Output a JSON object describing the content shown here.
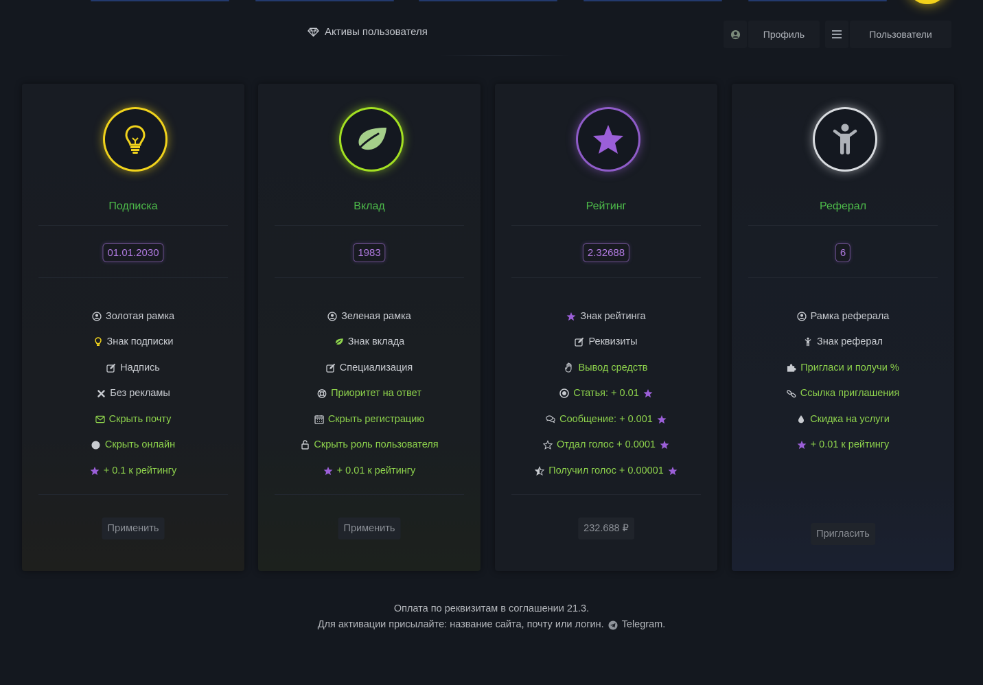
{
  "header": {
    "title": "Активы пользователя",
    "profile_label": "Профиль",
    "users_label": "Пользователи"
  },
  "cards": [
    {
      "title": "Подписка",
      "badge": "01.01.2030",
      "icon": "lightbulb-icon",
      "ring_color": "#f1d31c",
      "features": [
        {
          "icon": "user-circle-icon",
          "text": "Золотая рамка"
        },
        {
          "icon": "lightbulb-small-icon",
          "text": "Знак подписки"
        },
        {
          "icon": "edit-icon",
          "text": "Надпись"
        },
        {
          "icon": "cross-icon",
          "text": "Без рекламы"
        },
        {
          "icon": "envelope-icon",
          "text": "Скрыть почту"
        },
        {
          "icon": "circle-icon",
          "text": "Скрыть онлайн"
        },
        {
          "icon": "star-icon",
          "text": "+ 0.1 к рейтингу"
        }
      ],
      "action": "Применить"
    },
    {
      "title": "Вклад",
      "badge": "1983",
      "icon": "leaf-icon",
      "ring_color": "#a3e022",
      "features": [
        {
          "icon": "user-circle-icon",
          "text": "Зеленая рамка"
        },
        {
          "icon": "leaf-small-icon",
          "text": "Знак вклада"
        },
        {
          "icon": "edit-icon",
          "text": "Специализация"
        },
        {
          "icon": "lifebuoy-icon",
          "text": "Приоритет на ответ"
        },
        {
          "icon": "calendar-icon",
          "text": "Скрыть регистрацию"
        },
        {
          "icon": "unlock-icon",
          "text": "Скрыть роль пользователя"
        },
        {
          "icon": "star-icon",
          "text": "+ 0.01 к рейтингу"
        }
      ],
      "action": "Применить"
    },
    {
      "title": "Рейтинг",
      "badge": "2.32688",
      "icon": "star-large-icon",
      "ring_color": "#8f5cc9",
      "features": [
        {
          "icon": "star-icon",
          "text": "Знак рейтинга"
        },
        {
          "icon": "edit-icon",
          "text": "Реквизиты"
        },
        {
          "icon": "hand-icon",
          "text": "Вывод средств"
        },
        {
          "icon": "dot-circle-icon",
          "text": "Статья: + 0.01"
        },
        {
          "icon": "comments-icon",
          "text": "Сообщение: + 0.001"
        },
        {
          "icon": "star-outline-icon",
          "text": "Отдал голос + 0.0001"
        },
        {
          "icon": "star-half-icon",
          "text": "Получил голос + 0.00001"
        }
      ],
      "action": "232.688 ₽"
    },
    {
      "title": "Реферал",
      "badge": "6",
      "icon": "child-icon",
      "ring_color": "#d8dbdf",
      "features": [
        {
          "icon": "user-circle-icon",
          "text": "Рамка реферала"
        },
        {
          "icon": "child-small-icon",
          "text": "Знак реферал"
        },
        {
          "icon": "puzzle-icon",
          "text": "Пригласи и получи %"
        },
        {
          "icon": "link-icon",
          "text": "Ссылка приглашения"
        },
        {
          "icon": "drop-icon",
          "text": "Скидка на услуги"
        },
        {
          "icon": "star-icon",
          "text": "+ 0.01 к рейтингу"
        }
      ],
      "action": "Пригласить"
    }
  ],
  "footer": {
    "line1": "Оплата по реквизитам в соглашении 21.3.",
    "line2": "Для активации присылайте: название сайта, почту или логин.",
    "telegram": "Telegram",
    "period": "."
  }
}
